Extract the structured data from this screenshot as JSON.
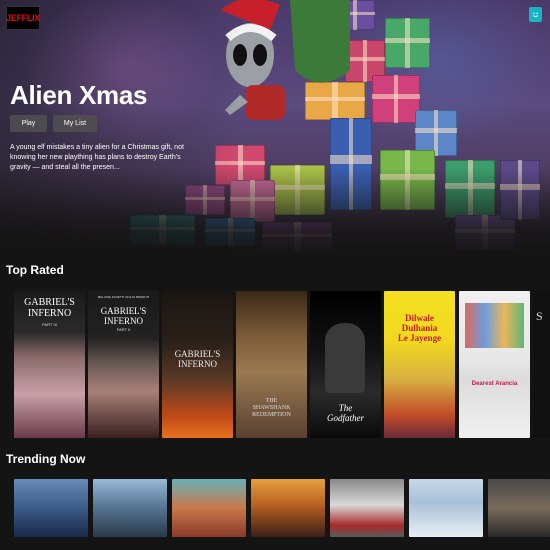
{
  "app": {
    "logo_text": "JEFFLIX",
    "profile_icon": "smile-face-icon",
    "accent": "#e50914"
  },
  "hero": {
    "title": "Alien Xmas",
    "play_label": "Play",
    "mylist_label": "My List",
    "description": "A young elf mistakes a tiny alien for a Christmas gift, not knowing her new plaything has plans to destroy Earth's gravity — and steal all the presen..."
  },
  "rows": {
    "top_rated": {
      "title": "Top Rated",
      "posters": [
        {
          "title": "GABRIEL'S\nINFERNO",
          "subtitle": "PART III"
        },
        {
          "title": "GABRIEL'S\nINFERNO",
          "subtitle": "PART II",
          "credits": "MELANIE ZANETTI    GIULIO BERRUTI"
        },
        {
          "title": "GABRIEL'S\nINFERNO",
          "subtitle": ""
        },
        {
          "title": "THE\nSHAWSHANK\nREDEMPTION",
          "subtitle": ""
        },
        {
          "title": "The\nGodfather",
          "subtitle": ""
        },
        {
          "title": "Dilwale\nDulhania\nLe Jayenge",
          "subtitle": ""
        },
        {
          "title": "Dearest Arancia",
          "subtitle": ""
        },
        {
          "title": "S",
          "subtitle": ""
        }
      ]
    },
    "trending_now": {
      "title": "Trending Now",
      "thumbs": [
        "thumb-1",
        "thumb-2",
        "thumb-3",
        "thumb-4",
        "thumb-5",
        "thumb-6",
        "thumb-7"
      ]
    }
  }
}
